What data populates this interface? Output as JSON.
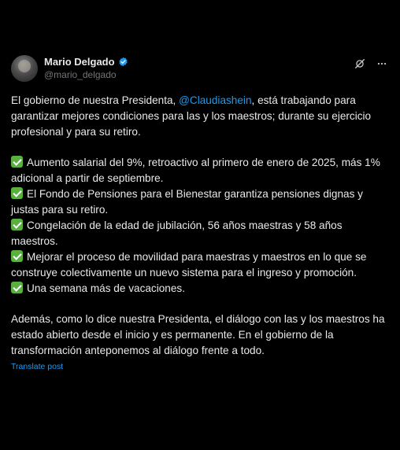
{
  "author": {
    "name": "Mario Delgado",
    "handle": "@mario_delgado",
    "verified_icon": "verified-badge-icon",
    "badge_color": "#1d9bf0"
  },
  "post": {
    "intro_before_mention": "El gobierno de nuestra Presidenta, ",
    "mention": "@Claudiashein",
    "intro_after_mention": ", está trabajando para garantizar mejores condiciones para las y los maestros; durante su ejercicio profesional y para su retiro.",
    "items": [
      "Aumento salarial del 9%, retroactivo al primero de enero de 2025, más 1% adicional a partir de septiembre.",
      "El Fondo de Pensiones para el Bienestar garantiza pensiones dignas y justas para su retiro.",
      "Congelación de la edad de jubilación, 56 años maestras y 58 años maestros.",
      "Mejorar el proceso de movilidad para maestras y maestros en lo que se construye colectivamente un nuevo sistema para el ingreso y promoción.",
      "Una semana más de vacaciones."
    ],
    "closing": "Además, como lo dice nuestra Presidenta, el diálogo con las y los maestros ha estado abierto desde el inicio y es permanente. En el gobierno de la transformación anteponemos al diálogo frente a todo.",
    "translate_label": "Translate post"
  },
  "colors": {
    "background": "#000000",
    "text": "#e7e9ea",
    "muted": "#71767b",
    "link": "#1d9bf0",
    "check": "#58b13f"
  }
}
